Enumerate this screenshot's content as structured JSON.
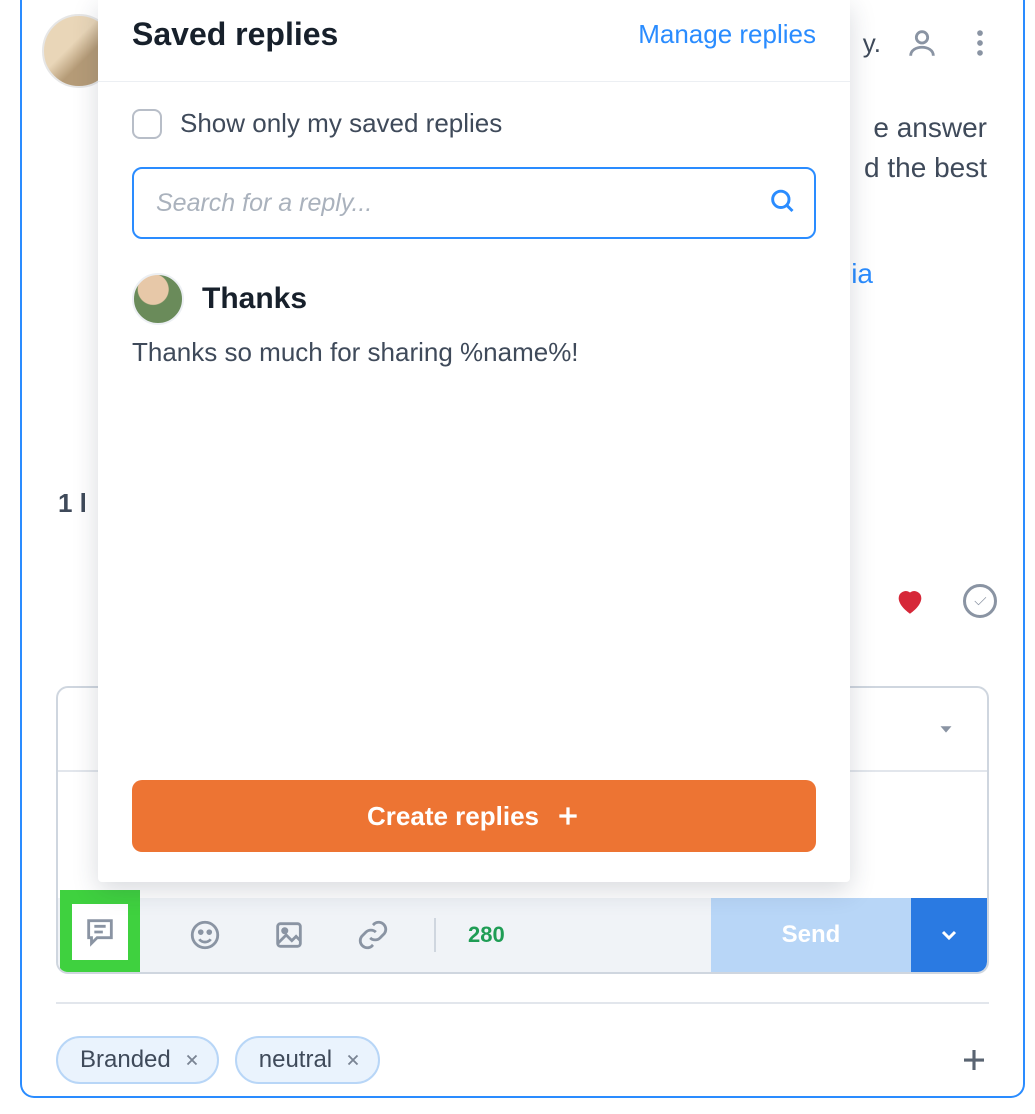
{
  "header": {
    "fragment": "y."
  },
  "background": {
    "msg_line1": "e answer",
    "msg_line2": "d the best",
    "link_fragment": "ia",
    "left_fragment": "1 l"
  },
  "popover": {
    "title": "Saved replies",
    "manage_link": "Manage replies",
    "checkbox_label": "Show only my saved replies",
    "search_placeholder": "Search for a reply...",
    "replies": [
      {
        "title": "Thanks",
        "body": "Thanks so much for sharing %name%!"
      }
    ],
    "create_label": "Create replies"
  },
  "composer": {
    "char_count": "280",
    "send_label": "Send"
  },
  "tags": [
    {
      "label": "Branded"
    },
    {
      "label": "neutral"
    }
  ]
}
